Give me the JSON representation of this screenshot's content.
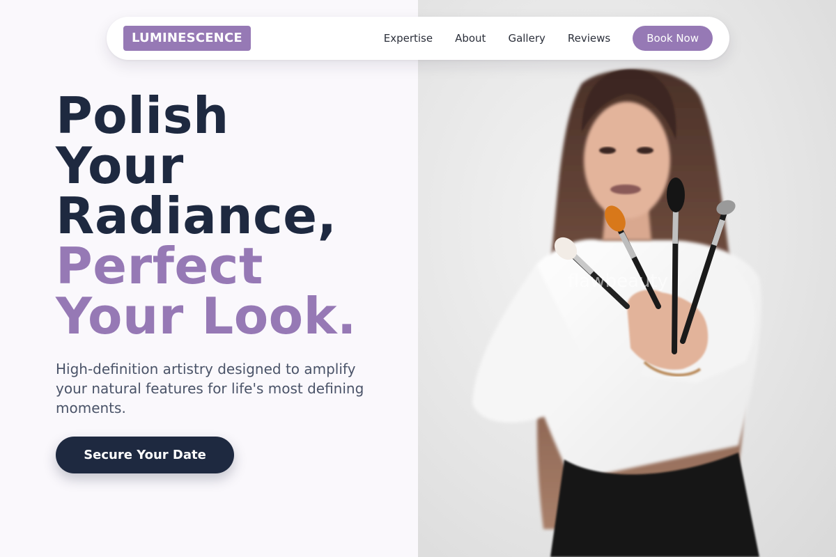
{
  "brand": {
    "name": "LUMINESCENCE",
    "color": "#9679b5"
  },
  "nav": {
    "links": [
      "Expertise",
      "About",
      "Gallery",
      "Reviews"
    ],
    "cta_label": "Book Now"
  },
  "hero": {
    "headline_lines": [
      "Polish",
      "Your",
      "Radiance,"
    ],
    "headline_accent_lines": [
      "Perfect",
      "Your Look."
    ],
    "subtext": "High-definition artistry designed to amplify your natural features for life's most defining moments.",
    "cta_label": "Secure Your Date",
    "photo_watermark": "flawbeauty"
  },
  "colors": {
    "accent": "#9679b5",
    "navy": "#1e2940",
    "background": "#faf8fc"
  }
}
